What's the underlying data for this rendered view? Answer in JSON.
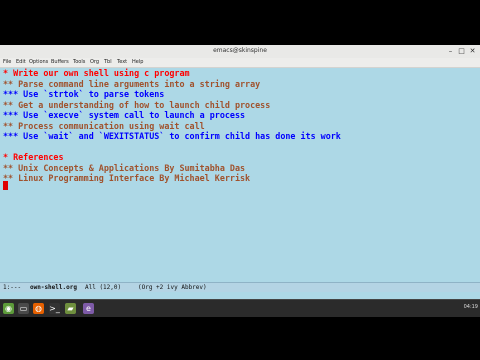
{
  "window": {
    "title": "emacs@skinspine",
    "controls": {
      "minimize": "–",
      "maximize": "□",
      "close": "✕"
    }
  },
  "menubar": {
    "items": [
      "File",
      "Edit",
      "Options",
      "Buffers",
      "Tools",
      "Org",
      "Tbl",
      "Text",
      "Help"
    ]
  },
  "editor": {
    "lines": [
      {
        "text": "* Write our own shell using c program",
        "level": 1
      },
      {
        "text": "** Parse command line arguments into a string array",
        "level": 2
      },
      {
        "text": "*** Use `strtok` to parse tokens",
        "level": 3
      },
      {
        "text": "** Get a understanding of how to launch child process",
        "level": 2
      },
      {
        "text": "*** Use `execve` system call to launch a process",
        "level": 3
      },
      {
        "text": "** Process communication using wait call",
        "level": 2
      },
      {
        "text": "*** Use `wait` and `WEXITSTATUS` to confirm child has done its work",
        "level": 3
      },
      {
        "text": "",
        "level": 0
      },
      {
        "text": "* References",
        "level": 1
      },
      {
        "text": "** Unix Concepts & Applications By Sumitabha Das",
        "level": 2
      },
      {
        "text": "** Linux Programming Interface By Michael Kerrisk",
        "level": 2
      }
    ]
  },
  "modeline": {
    "status": "1:---",
    "buffer": "own-shell.org",
    "position": "All (12,0)",
    "modes": "(Org +2 ivy Abbrev)"
  },
  "taskbar": {
    "apps": [
      {
        "name": "menu-icon",
        "glyph": "◉",
        "color": "#5d9b3a"
      },
      {
        "name": "desktop-icon",
        "glyph": "▭",
        "color": "#4a4a4a"
      },
      {
        "name": "firefox-icon",
        "glyph": "◍",
        "color": "#e66000"
      },
      {
        "name": "terminal-icon",
        "glyph": ">_",
        "color": "#333333"
      },
      {
        "name": "files-icon",
        "glyph": "▰",
        "color": "#6f8f3e"
      },
      {
        "name": "emacs-icon",
        "glyph": "e",
        "color": "#7e5ba8"
      }
    ],
    "clock": "04:19"
  },
  "colors": {
    "level1": "#ff0000",
    "level2": "#a0522d",
    "level3": "#0000ff",
    "background": "#add8e6"
  }
}
